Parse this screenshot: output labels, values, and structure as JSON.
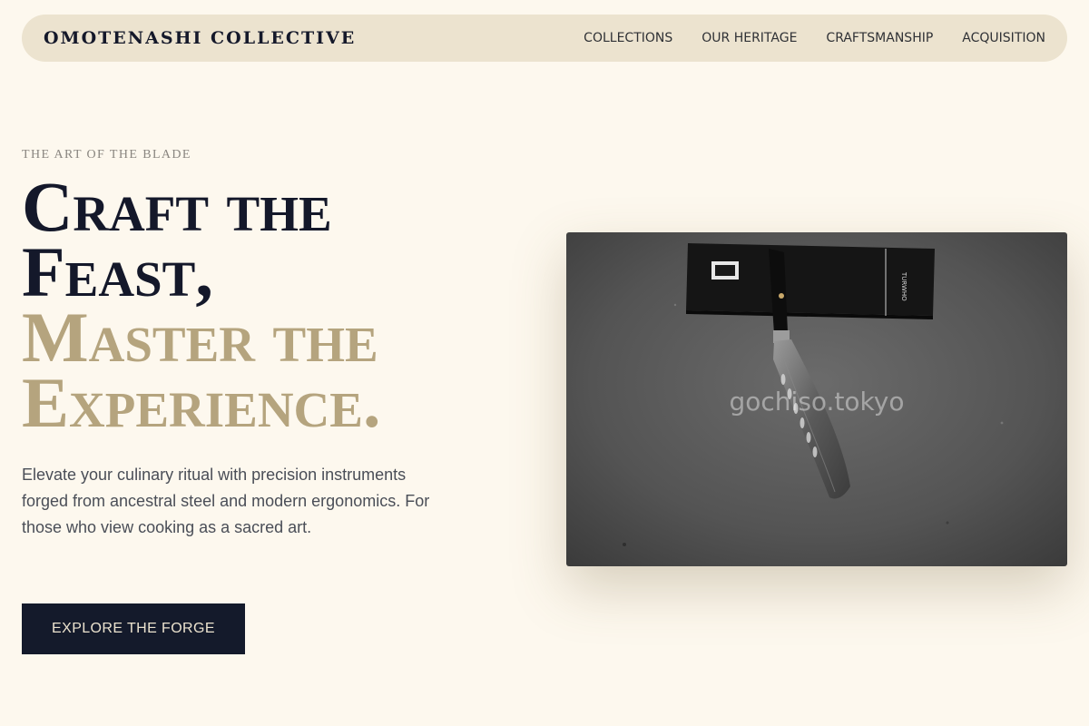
{
  "nav": {
    "brand": "OMOTENASHI COLLECTIVE",
    "links": [
      "COLLECTIONS",
      "OUR HERITAGE",
      "CRAFTSMANSHIP",
      "ACQUISITION"
    ]
  },
  "hero": {
    "eyebrow": "THE ART OF THE BLADE",
    "headline_lines": [
      "Craft the",
      "Feast,"
    ],
    "headline_accent_lines": [
      "Master the",
      "Experience."
    ],
    "description": "Elevate your culinary ritual with precision instruments forged from ancestral steel and modern ergonomics. For those who view cooking as a sacred art.",
    "cta_label": "EXPLORE THE FORGE"
  },
  "image": {
    "watermark": "gochiso.tokyo",
    "box_label": "TURWHO"
  },
  "colors": {
    "background": "#fdf8ee",
    "navbar": "#ece3cf",
    "ink": "#14182a",
    "accent": "#b5a47e",
    "button": "#141a2b"
  }
}
